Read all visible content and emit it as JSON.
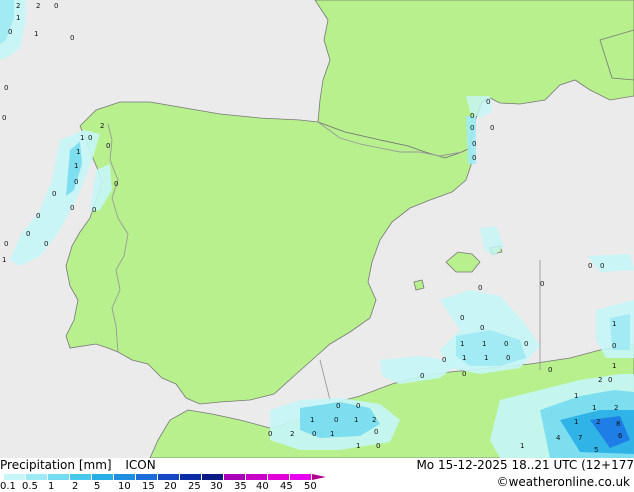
{
  "product": "Precipitation [mm]",
  "model": "ICON",
  "valid_time": "Mo 15-12-2025 18..21 UTC (12+177",
  "credit": "©weatheronline.co.uk",
  "colors": {
    "sea": "#ebebeb",
    "land": "#b7f08c",
    "border": "#9a9a9a",
    "coast": "#777777",
    "precip_light": "#b3f0f5",
    "precip_mid": "#5ad2ee",
    "precip_heavy": "#1e78e6"
  },
  "legend": {
    "ticks": [
      "0.1",
      "0.5",
      "1",
      "2",
      "5",
      "10",
      "15",
      "20",
      "25",
      "30",
      "35",
      "40",
      "45",
      "50"
    ],
    "swatches": [
      "#c6f6f7",
      "#9eeaf4",
      "#74dcf0",
      "#48c8ec",
      "#28aee6",
      "#1e8ee0",
      "#1a6cd8",
      "#1448c4",
      "#0c2ca6",
      "#0c1a86",
      "#a800b8",
      "#c800c8",
      "#e000d8",
      "#e800f0"
    ]
  },
  "precip_labels": [
    {
      "t": "2"
    },
    {
      "t": "2"
    },
    {
      "t": "0"
    },
    {
      "t": "1"
    },
    {
      "t": "0"
    },
    {
      "t": "1"
    },
    {
      "t": "0"
    },
    {
      "t": "0"
    },
    {
      "t": "0"
    },
    {
      "t": "2"
    },
    {
      "t": "1"
    },
    {
      "t": "0"
    },
    {
      "t": "1"
    },
    {
      "t": "1"
    },
    {
      "t": "0"
    },
    {
      "t": "0"
    },
    {
      "t": "0"
    },
    {
      "t": "0"
    },
    {
      "t": "0"
    },
    {
      "t": "0"
    },
    {
      "t": "0"
    },
    {
      "t": "0"
    },
    {
      "t": "1"
    },
    {
      "t": "0"
    },
    {
      "t": "0"
    },
    {
      "t": "0"
    },
    {
      "t": "0"
    },
    {
      "t": "0"
    },
    {
      "t": "0"
    },
    {
      "t": "0"
    },
    {
      "t": "0"
    },
    {
      "t": "0"
    },
    {
      "t": "0"
    },
    {
      "t": "0"
    },
    {
      "t": "0"
    },
    {
      "t": "1"
    },
    {
      "t": "1"
    },
    {
      "t": "0"
    },
    {
      "t": "1"
    },
    {
      "t": "1"
    },
    {
      "t": "0"
    },
    {
      "t": "0"
    },
    {
      "t": "0"
    },
    {
      "t": "0"
    },
    {
      "t": "0"
    },
    {
      "t": "0"
    },
    {
      "t": "0"
    },
    {
      "t": "0"
    },
    {
      "t": "1"
    },
    {
      "t": "0"
    },
    {
      "t": "0"
    },
    {
      "t": "1"
    },
    {
      "t": "2"
    },
    {
      "t": "1"
    },
    {
      "t": "1"
    },
    {
      "t": "2"
    },
    {
      "t": "1"
    },
    {
      "t": "2"
    },
    {
      "t": "8"
    },
    {
      "t": "6"
    },
    {
      "t": "7"
    },
    {
      "t": "4"
    },
    {
      "t": "5"
    },
    {
      "t": "1"
    },
    {
      "t": "1"
    },
    {
      "t": "2"
    },
    {
      "t": "0"
    },
    {
      "t": "0"
    },
    {
      "t": "0"
    },
    {
      "t": "2"
    },
    {
      "t": "1"
    },
    {
      "t": "0"
    },
    {
      "t": "0"
    },
    {
      "t": "1"
    },
    {
      "t": "1"
    },
    {
      "t": "0"
    },
    {
      "t": "0"
    }
  ]
}
